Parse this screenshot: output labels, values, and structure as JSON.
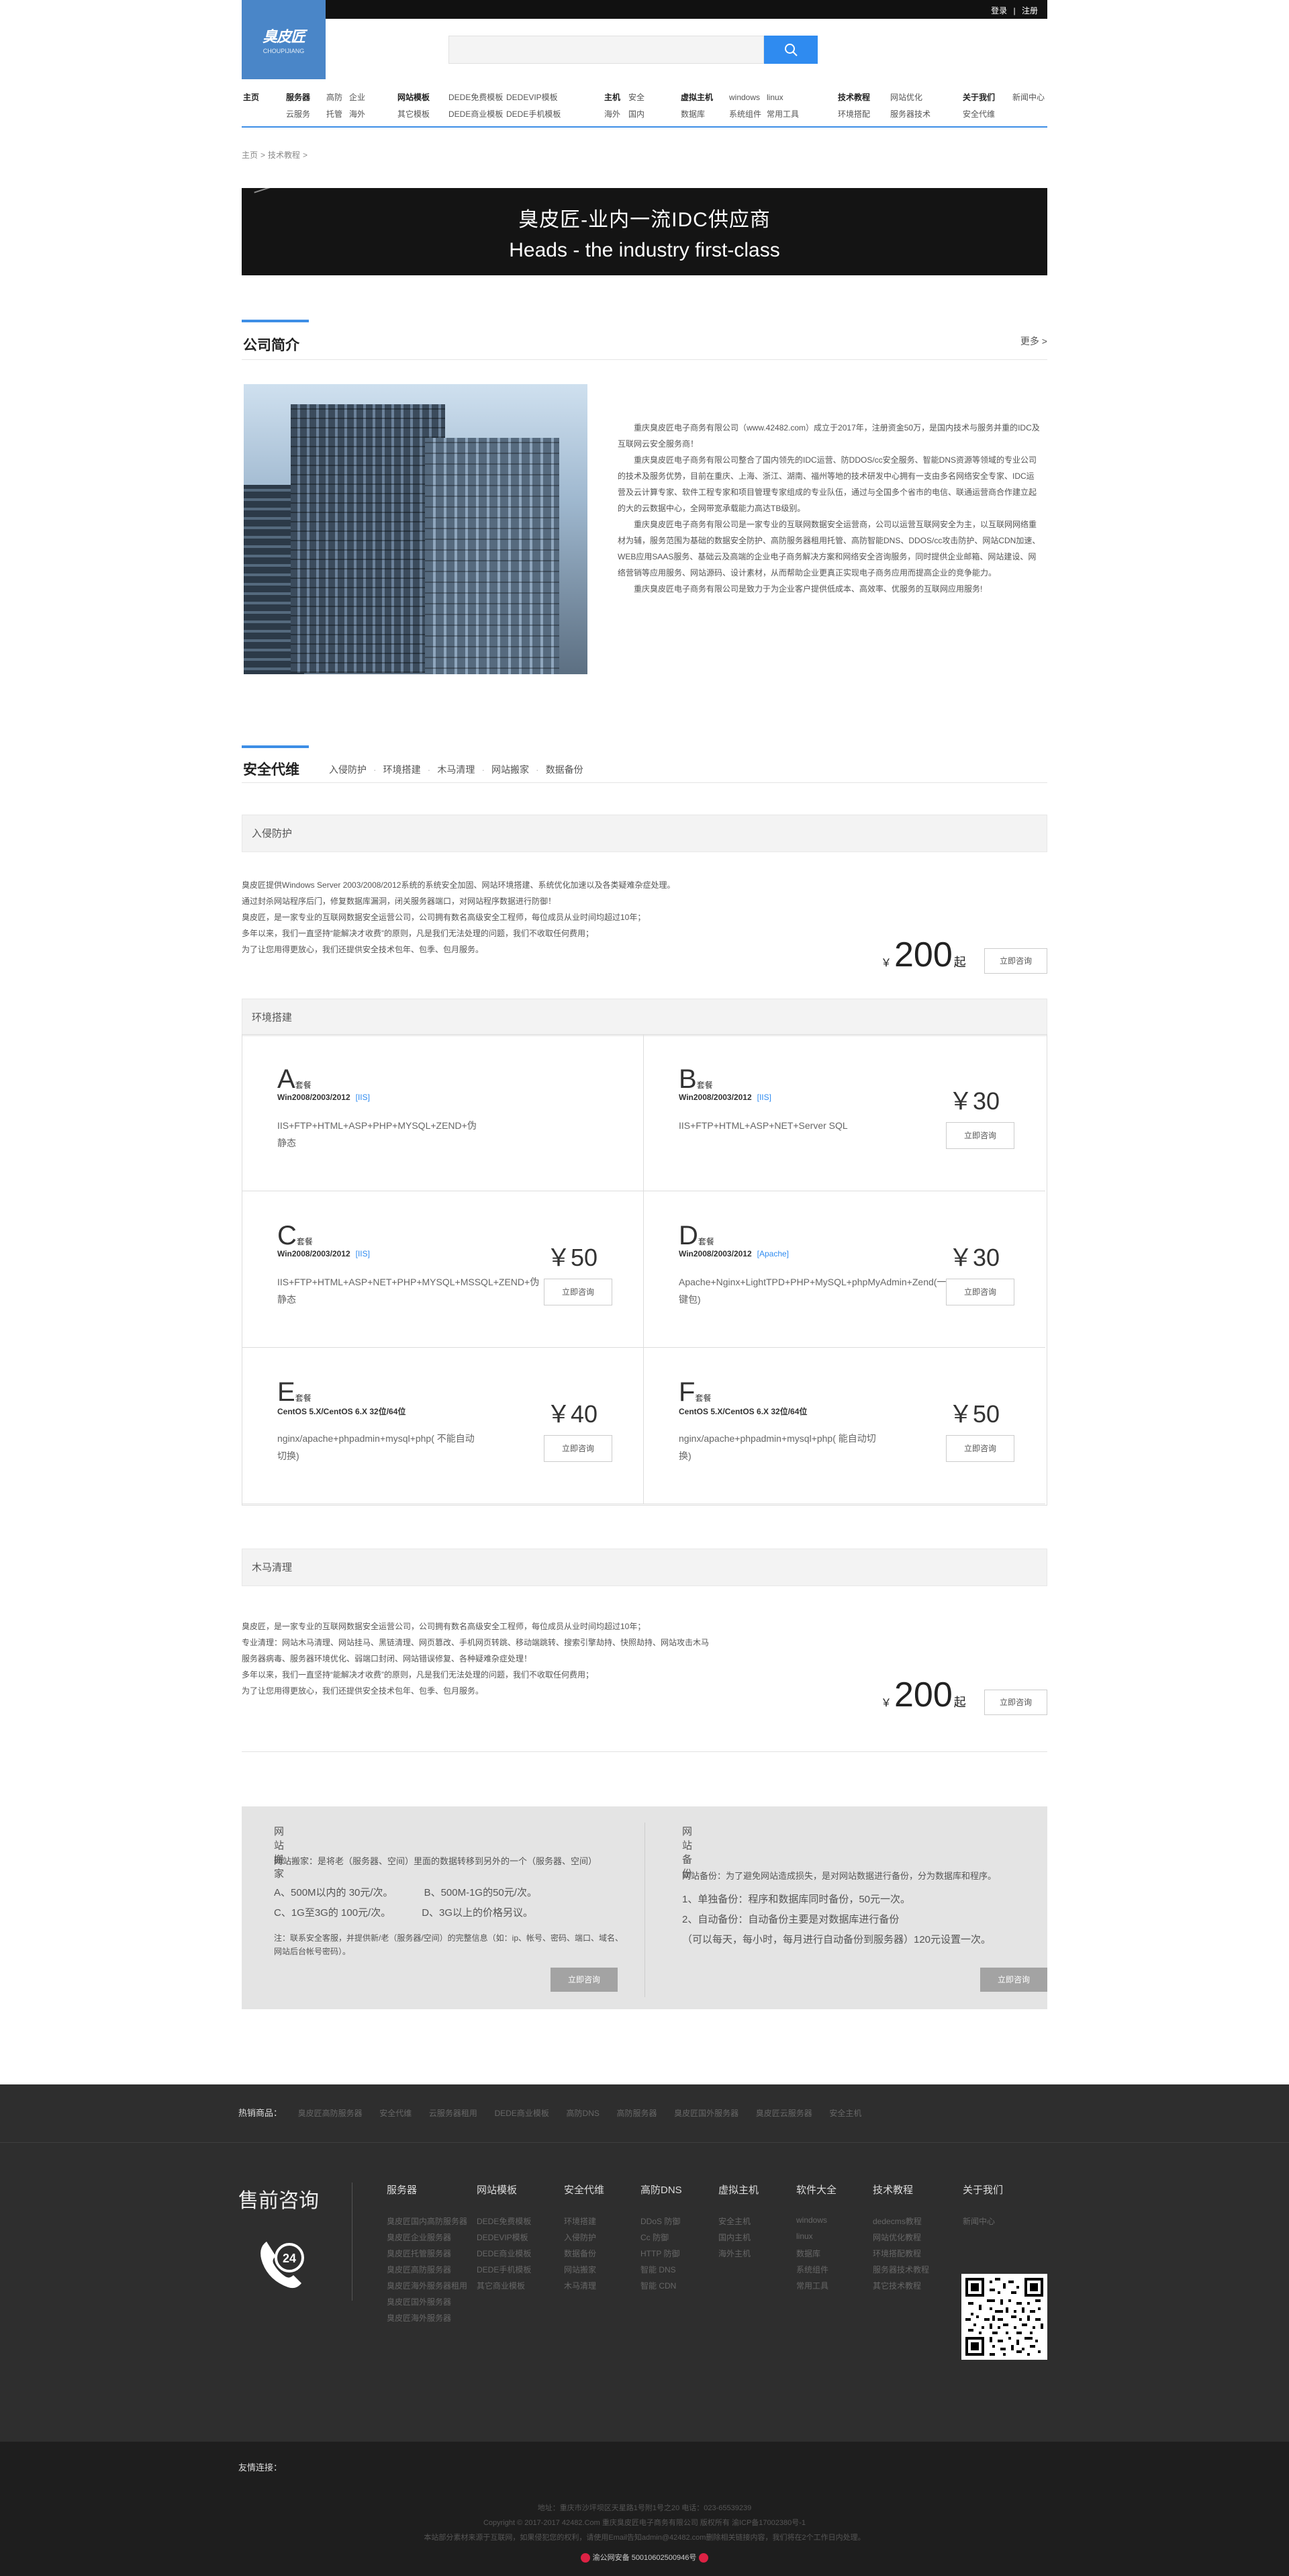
{
  "top": {
    "login": "登录",
    "sep": "|",
    "register": "注册"
  },
  "logo": {
    "name": "臭皮匠",
    "sub": "CHOUPIJIANG"
  },
  "search": {
    "placeholder": ""
  },
  "nav": {
    "home": "主页",
    "groups": [
      {
        "title": "服务器",
        "cols": [
          [
            "高防",
            "云服务"
          ],
          [
            "企业",
            "托管"
          ],
          [
            "",
            "海外"
          ]
        ]
      },
      {
        "title": "网站模板",
        "cols": [
          [
            "DEDE免费模板",
            "其它模板"
          ],
          [
            "DEDEVIP模板",
            "DEDE商业模板"
          ],
          [
            "",
            "DEDE手机模板"
          ]
        ]
      },
      {
        "title": "主机",
        "cols": [
          [
            "安全",
            "海外"
          ],
          [
            "",
            "国内"
          ]
        ]
      },
      {
        "title": "虚拟主机",
        "cols": [
          [
            "windows",
            "数据库"
          ],
          [
            "linux",
            "系统组件"
          ],
          [
            "",
            "常用工具"
          ]
        ]
      },
      {
        "title": "技术教程",
        "cols": [
          [
            "网站优化",
            "环境搭配"
          ],
          [
            "",
            "服务器技术"
          ]
        ]
      },
      {
        "title": "关于我们",
        "cols": [
          [
            "新闻中心",
            "安全代维"
          ]
        ]
      }
    ]
  },
  "breadcrumb": {
    "home": "主页",
    "current": "技术教程",
    "arrow": ">"
  },
  "banner": {
    "line1": "臭皮匠-业内一流IDC供应商",
    "line2": "Heads - the industry first-class"
  },
  "company": {
    "title": "公司简介",
    "more": "更多 >",
    "paragraphs": [
      "重庆臭皮匠电子商务有限公司（www.42482.com）成立于2017年，注册资金50万，是国内技术与服务并重的IDC及互联网云安全服务商！",
      "重庆臭皮匠电子商务有限公司整合了国内领先的IDC运营、防DDOS/cc安全服务、智能DNS资源等领域的专业公司的技术及服务优势，目前在重庆、上海、浙江、湖南、福州等地的技术研发中心拥有一支由多名网络安全专家、IDC运营及云计算专家、软件工程专家和项目管理专家组成的专业队伍，通过与全国多个省市的电信、联通运营商合作建立起的大的云数据中心，全网带宽承载能力高达TB级别。",
      "重庆臭皮匠电子商务有限公司是一家专业的互联网数据安全运营商，公司以运营互联网安全为主，以互联网网络重材为辅，服务范围为基础的数据安全防护、高防服务器租用托管、高防智能DNS、DDOS/cc攻击防护、网站CDN加速、WEB应用SAAS服务、基础云及高端的企业电子商务解决方案和网络安全咨询服务，同时提供企业邮箱、网站建设、网络营销等应用服务、网站源码、设计素材，从而帮助企业更真正实现电子商务应用而提高企业的竞争能力。",
      "重庆臭皮匠电子商务有限公司是致力于为企业客户提供低成本、高效率、优服务的互联网应用服务!"
    ]
  },
  "tabs": {
    "title": "安全代维",
    "items": [
      "入侵防护",
      "环境搭建",
      "木马清理",
      "网站搬家",
      "数据备份"
    ],
    "dot": "·"
  },
  "intrusion": {
    "head": "入侵防护",
    "lines": [
      "臭皮匠提供Windows Server 2003/2008/2012系统的系统安全加固、网站环境搭建、系统优化加速以及各类疑难杂症处理。",
      "通过封杀网站程序后门，修复数据库漏洞，闭关服务器端口，对网站程序数据进行防御！",
      "臭皮匠，是一家专业的互联网数据安全运营公司，公司拥有数名高级安全工程师，每位成员从业时间均超过10年；",
      "多年以来，我们一直坚持“能解决才收费”的原则，凡是我们无法处理的问题，我们不收取任何费用；",
      "为了让您用得更放心，我们还提供安全技术包年、包季、包月服务。"
    ],
    "cur": "￥",
    "price": "200",
    "unit": "起",
    "btn": "立即咨询"
  },
  "env": {
    "head": "环境搭建",
    "packages": [
      {
        "letter": "A",
        "tc": "套餐",
        "os": "Win2008/2003/2012",
        "tag": "[IIS]",
        "feat": "IIS+FTP+HTML+ASP+PHP+MYSQL+ZEND+伪静态",
        "price": "",
        "btn": ""
      },
      {
        "letter": "B",
        "tc": "套餐",
        "os": "Win2008/2003/2012",
        "tag": "[IIS]",
        "feat": "IIS+FTP+HTML+ASP+NET+Server SQL",
        "price": "30",
        "btn": "立即咨询"
      },
      {
        "letter": "C",
        "tc": "套餐",
        "os": "Win2008/2003/2012",
        "tag": "[IIS]",
        "feat": "IIS+FTP+HTML+ASP+NET+PHP+MYSQL+MSSQL+ZEND+伪静态",
        "price": "50",
        "btn": "立即咨询"
      },
      {
        "letter": "D",
        "tc": "套餐",
        "os": "Win2008/2003/2012",
        "tag": "[Apache]",
        "feat": "Apache+Nginx+LightTPD+PHP+MySQL+phpMyAdmin+Zend(一键包)",
        "price": "30",
        "btn": "立即咨询"
      },
      {
        "letter": "E",
        "tc": "套餐",
        "os": "CentOS 5.X/CentOS 6.X 32位/64位",
        "tag": "",
        "feat": "nginx/apache+phpadmin+mysql+php( 不能自动切换)",
        "price": "40",
        "btn": "立即咨询"
      },
      {
        "letter": "F",
        "tc": "套餐",
        "os": "CentOS 5.X/CentOS 6.X 32位/64位",
        "tag": "",
        "feat": "nginx/apache+phpadmin+mysql+php( 能自动切换)",
        "price": "50",
        "btn": "立即咨询"
      }
    ],
    "cur": "￥"
  },
  "trojan": {
    "head": "木马清理",
    "lines": [
      "臭皮匠，是一家专业的互联网数据安全运营公司，公司拥有数名高级安全工程师，每位成员从业时间均超过10年；",
      "专业清理：网站木马清理、网站挂马、黑链清理、网页篡改、手机网页转跳、移动端跳转、搜索引擎劫持、快照劫持、网站攻击木马",
      "服务器病毒、服务器环境优化、弱端口封闭、网站错误修复、各种疑难杂症处理！",
      "多年以来，我们一直坚持“能解决才收费”的原则，凡是我们无法处理的问题，我们不收取任何费用；",
      "为了让您用得更放心，我们还提供安全技术包年、包季、包月服务。"
    ],
    "cur": "￥",
    "price": "200",
    "unit": "起",
    "btn": "立即咨询"
  },
  "migration": {
    "left": {
      "head": "网站搬家",
      "desc": "网站搬家：是将老（服务器、空间）里面的数据转移到另外的一个（服务器、空间）",
      "list": [
        "A、500M以内的 30元/次。",
        "B、500M-1G的50元/次。",
        "C、1G至3G的 100元/次。",
        "D、3G以上的价格另议。"
      ],
      "note": "注：联系安全客服，并提供新/老（服务器/空间）的完整信息（如：ip、帐号、密码、端口、域名、网站后台帐号密码）。",
      "btn": "立即咨询"
    },
    "right": {
      "head": "网站备份",
      "desc": "网站备份：为了避免网站造成损失，是对网站数据进行备份，分为数据库和程序。",
      "list": [
        "1、单独备份：程序和数据库同时备份，50元一次。",
        "2、自动备份：自动备份主要是对数据库进行备份",
        "（可以每天，每小时，每月进行自动备份到服务器）120元设置一次。"
      ],
      "btn": "立即咨询"
    }
  },
  "footer": {
    "hot_label": "热销商品：",
    "hot": [
      "臭皮匠高防服务器",
      "安全代维",
      "云服务器租用",
      "DEDE商业模板",
      "高防DNS",
      "高防服务器",
      "臭皮匠国外服务器",
      "臭皮匠云服务器",
      "安全主机"
    ],
    "cs": "售前咨询",
    "cols": [
      {
        "h": "服务器",
        "items": [
          "臭皮匠国内高防服务器",
          "臭皮匠企业服务器",
          "臭皮匠托管服务器",
          "臭皮匠高防服务器",
          "臭皮匠海外服务器租用",
          "臭皮匠国外服务器",
          "臭皮匠海外服务器"
        ]
      },
      {
        "h": "网站模板",
        "items": [
          "DEDE免费模板",
          "DEDEVIP模板",
          "DEDE商业模板",
          "DEDE手机模板",
          "其它商业模板"
        ]
      },
      {
        "h": "安全代维",
        "items": [
          "环境搭建",
          "入侵防护",
          "数据备份",
          "网站搬家",
          "木马清理"
        ]
      },
      {
        "h": "高防DNS",
        "items": [
          "DDoS 防御",
          "Cc 防御",
          "HTTP 防御",
          "智能 DNS",
          "智能 CDN"
        ]
      },
      {
        "h": "虚拟主机",
        "items": [
          "安全主机",
          "国内主机",
          "海外主机"
        ]
      },
      {
        "h": "软件大全",
        "items": [
          "windows",
          "linux",
          "数据库",
          "系统组件",
          "常用工具"
        ]
      },
      {
        "h": "技术教程",
        "items": [
          "dedecms教程",
          "网站优化教程",
          "环境搭配教程",
          "服务器技术教程",
          "其它技术教程"
        ]
      },
      {
        "h": "关于我们",
        "items": [
          "新闻中心"
        ]
      }
    ],
    "friend": "友情连接：",
    "copy": [
      "地址：重庆市沙坪坝区天星路1号附1号之20 电话：023-65539239",
      "Copyright © 2017-2017 42482.Com 重庆臭皮匠电子商务有限公司 版权所有 渝ICP备17002380号-1",
      "本站部分素材来源于互联网，如果侵犯您的权利，请使用Email告知admin@42482.com删除相关链接内容，我们将在2个工作日内处理。"
    ],
    "gongan": "渝公网安备 50010602500946号"
  }
}
